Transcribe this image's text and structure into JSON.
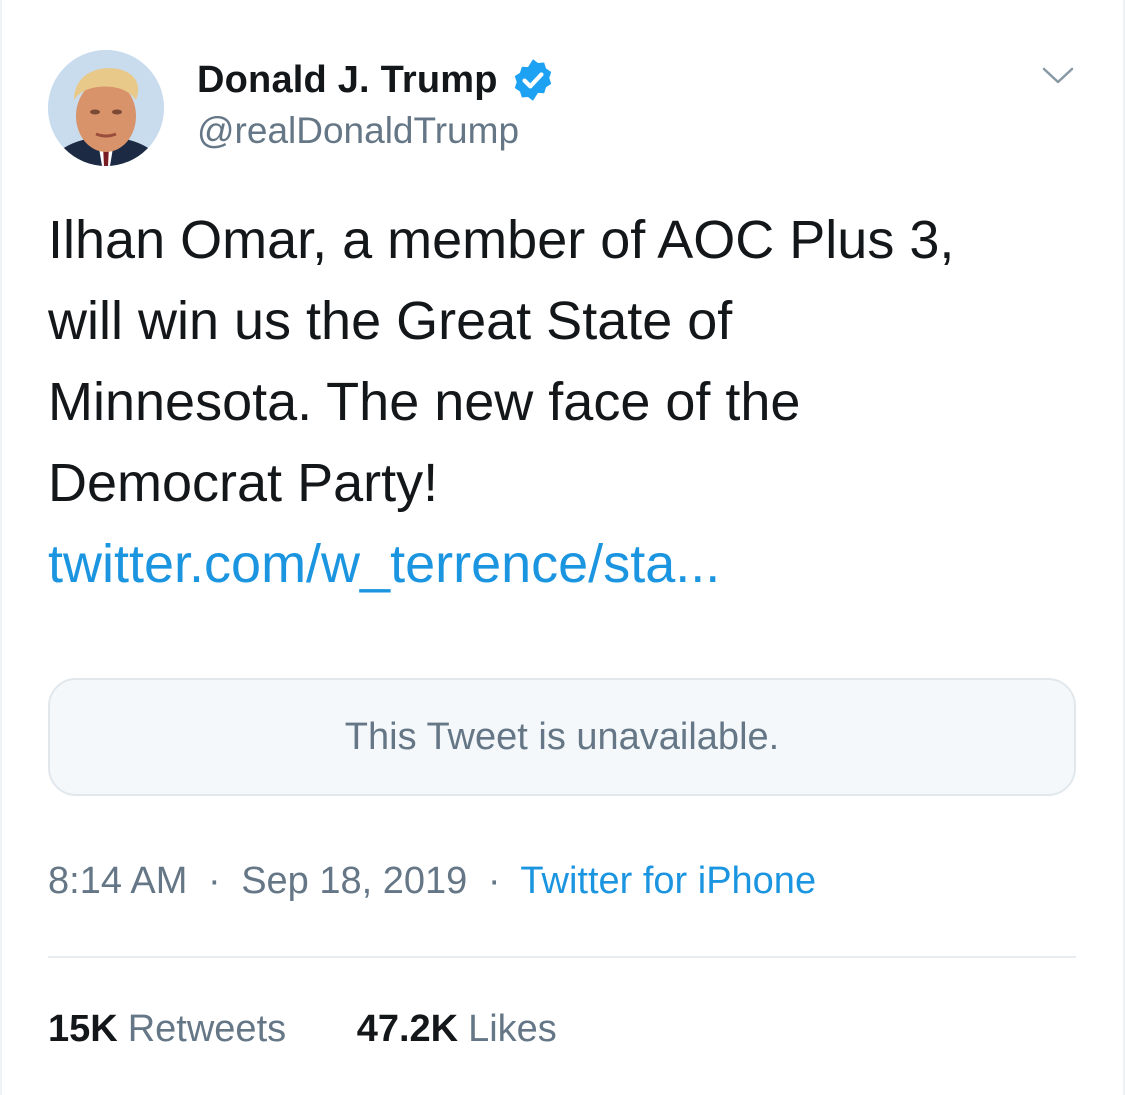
{
  "author": {
    "display_name": "Donald J. Trump",
    "handle": "@realDonaldTrump",
    "verified_icon": "verified-badge-icon"
  },
  "menu": {
    "icon": "chevron-down-icon"
  },
  "tweet": {
    "lines": [
      "Ilhan Omar, a member of AOC Plus 3,",
      "will win us the Great State of",
      "Minnesota. The new face of the",
      "Democrat Party!"
    ],
    "link": "twitter.com/w_terrence/sta..."
  },
  "quote": {
    "text": "This Tweet is unavailable."
  },
  "meta": {
    "time": "8:14 AM",
    "separator": "·",
    "date": "Sep 18, 2019",
    "source": "Twitter for iPhone"
  },
  "stats": {
    "retweets_count": "15K",
    "retweets_label": "Retweets",
    "likes_count": "47.2K",
    "likes_label": "Likes"
  },
  "colors": {
    "link": "#1b95e0",
    "text": "#14171a",
    "muted": "#657786",
    "verified": "#1da1f2"
  }
}
